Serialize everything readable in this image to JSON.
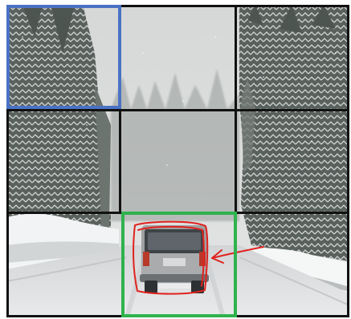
{
  "grid": {
    "rows": 3,
    "cols": 3,
    "line_color": "#111111"
  },
  "scene": {
    "subject": "snowy-road-with-suv-icon",
    "sky_color": "#dadcdc",
    "snow_color": "#f1f2f3",
    "road_color": "#d9dadc",
    "tree_color": "#5b6460"
  },
  "highlights": {
    "blue_cell_color": "#4a72c4",
    "green_cell_color": "#2fb24d",
    "annotation_color": "#e0221e"
  }
}
